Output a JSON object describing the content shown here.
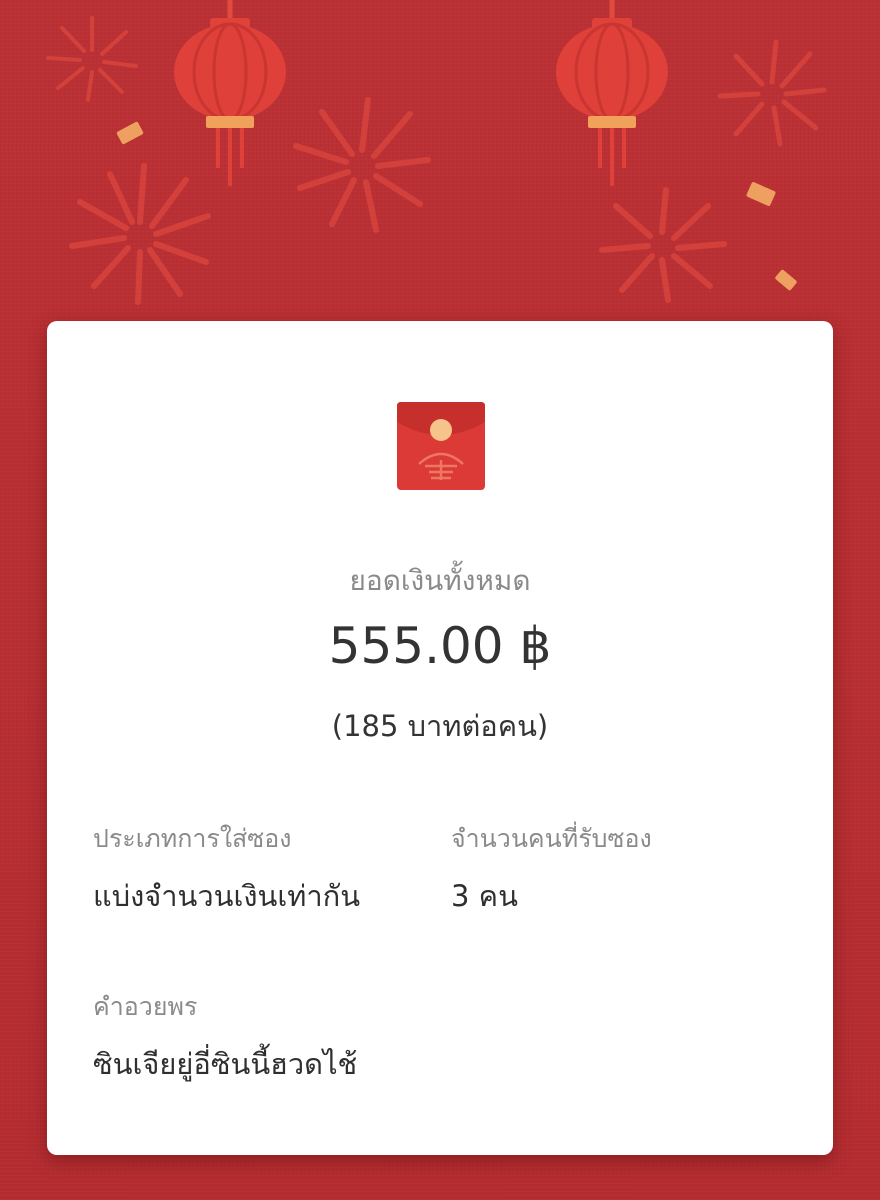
{
  "summary": {
    "total_label": "ยอดเงินทั้งหมด",
    "total_amount": "555.00 ฿",
    "per_person": "(185 บาทต่อคน)"
  },
  "details": {
    "type_label": "ประเภทการใส่ซอง",
    "type_value": "แบ่งจำนวนเงินเท่ากัน",
    "recipients_label": "จำนวนคนที่รับซอง",
    "recipients_value": "3 คน",
    "greeting_label": "คำอวยพร",
    "greeting_value": "ซินเจียยู่อี่ซินนี้ฮวดไช้"
  },
  "theme": {
    "background": "#b92e32",
    "lantern": "#dd3b35",
    "lantern_gold": "#f0a25a",
    "firework": "#d9433c",
    "envelope": "#dc3a36",
    "envelope_seal": "#f6c38a"
  }
}
